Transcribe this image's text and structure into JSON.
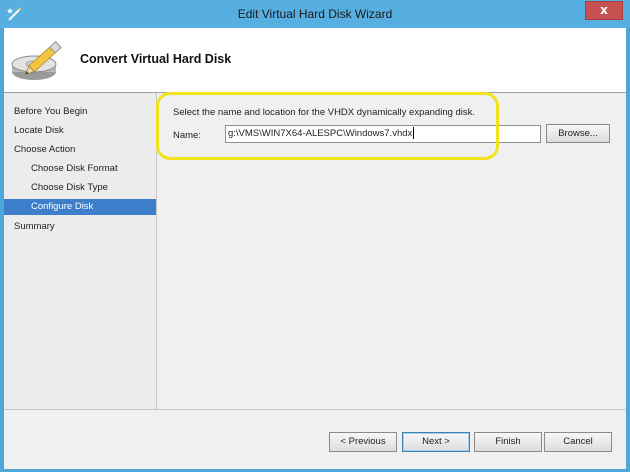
{
  "window": {
    "title": "Edit Virtual Hard Disk Wizard",
    "close_glyph": "x",
    "app_icon": "wizard-wand-icon"
  },
  "header": {
    "title": "Convert Virtual Hard Disk",
    "icon": "hard-disk-pencil-icon"
  },
  "nav": {
    "items": [
      {
        "label": "Before You Begin",
        "level": 1,
        "selected": false
      },
      {
        "label": "Locate Disk",
        "level": 1,
        "selected": false
      },
      {
        "label": "Choose Action",
        "level": 1,
        "selected": false
      },
      {
        "label": "Choose Disk Format",
        "level": 2,
        "selected": false
      },
      {
        "label": "Choose Disk Type",
        "level": 2,
        "selected": false
      },
      {
        "label": "Configure Disk",
        "level": 2,
        "selected": true
      },
      {
        "label": "Summary",
        "level": 1,
        "selected": false
      }
    ]
  },
  "configure": {
    "instruction": "Select the name and location for the VHDX dynamically expanding disk.",
    "name_label": "Name:",
    "name_value": "g:\\VMS\\WIN7X64-ALESPC\\Windows7.vhdx",
    "browse_label": "Browse..."
  },
  "footer": {
    "previous_label": "< Previous",
    "next_label": "Next >",
    "finish_label": "Finish",
    "cancel_label": "Cancel"
  },
  "colors": {
    "titlebar": "#57aee0",
    "selected_nav": "#3d7ecb",
    "highlight": "#f2e21a",
    "close_button": "#c75050"
  }
}
